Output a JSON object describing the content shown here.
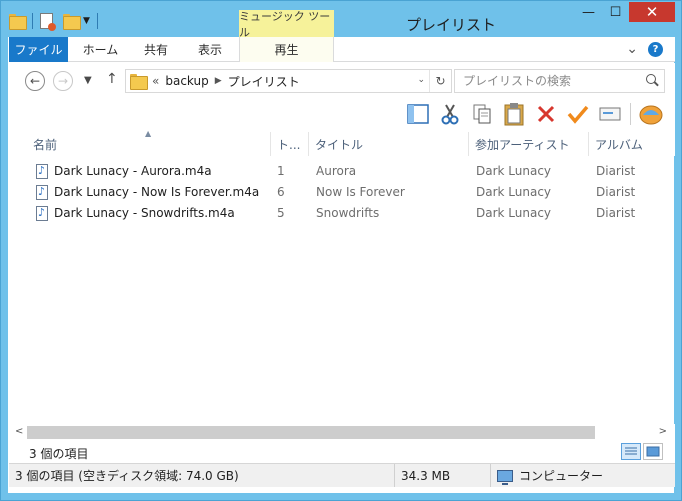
{
  "window": {
    "title": "プレイリスト",
    "context_tab_header": "ミュージック ツール",
    "caption": {
      "minimize": "—",
      "maximize": "☐",
      "close": "✕"
    }
  },
  "ribbon": {
    "tabs": [
      "ファイル",
      "ホーム",
      "共有",
      "表示",
      "再生"
    ],
    "expand_glyph": "⌄",
    "help": "?"
  },
  "address": {
    "prefix": "«",
    "crumbs": [
      "backup",
      "プレイリスト"
    ],
    "search_placeholder": "プレイリストの検索"
  },
  "toolbar": {
    "icons": [
      "layout-pane-icon",
      "cut-icon",
      "copy-icon",
      "paste-icon",
      "delete-icon",
      "checkmark-icon",
      "rename-icon",
      "shell-icon"
    ]
  },
  "columns": [
    "名前",
    "ト...",
    "タイトル",
    "参加アーティスト",
    "アルバム"
  ],
  "files": [
    {
      "name": "Dark Lunacy - Aurora.m4a",
      "track": "1",
      "title": "Aurora",
      "artist": "Dark Lunacy",
      "album": "Diarist"
    },
    {
      "name": "Dark Lunacy - Now Is Forever.m4a",
      "track": "6",
      "title": "Now Is Forever",
      "artist": "Dark Lunacy",
      "album": "Diarist"
    },
    {
      "name": "Dark Lunacy - Snowdrifts.m4a",
      "track": "5",
      "title": "Snowdrifts",
      "artist": "Dark Lunacy",
      "album": "Diarist"
    }
  ],
  "status": {
    "item_count": "3 個の項目",
    "selection_info": "3 個の項目 (空きディスク領域: 74.0 GB)",
    "size": "34.3 MB",
    "location": "コンピューター"
  },
  "colors": {
    "accent": "#1979ca",
    "frame": "#6fc1ea",
    "close": "#c7382e",
    "context_tab": "#f6f29a"
  }
}
